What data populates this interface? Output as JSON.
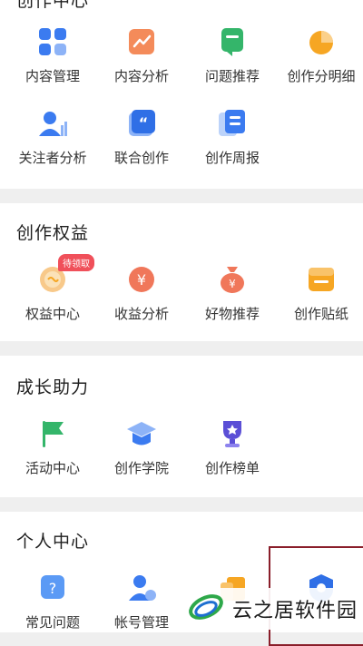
{
  "sections": {
    "creation": {
      "title": "创作中心",
      "items": [
        {
          "label": "内容管理",
          "icon": "grid-icon"
        },
        {
          "label": "内容分析",
          "icon": "chart-icon"
        },
        {
          "label": "问题推荐",
          "icon": "question-card-icon"
        },
        {
          "label": "创作分明细",
          "icon": "pie-icon"
        },
        {
          "label": "关注者分析",
          "icon": "follower-icon"
        },
        {
          "label": "联合创作",
          "icon": "quote-icon"
        },
        {
          "label": "创作周报",
          "icon": "report-icon"
        }
      ]
    },
    "rights": {
      "title": "创作权益",
      "items": [
        {
          "label": "权益中心",
          "icon": "rights-icon",
          "badge": "待领取"
        },
        {
          "label": "收益分析",
          "icon": "yuan-icon"
        },
        {
          "label": "好物推荐",
          "icon": "money-bag-icon"
        },
        {
          "label": "创作贴纸",
          "icon": "sticker-icon"
        }
      ]
    },
    "growth": {
      "title": "成长助力",
      "items": [
        {
          "label": "活动中心",
          "icon": "flag-icon"
        },
        {
          "label": "创作学院",
          "icon": "graduation-cap-icon"
        },
        {
          "label": "创作榜单",
          "icon": "trophy-icon"
        }
      ]
    },
    "personal": {
      "title": "个人中心",
      "items": [
        {
          "label": "常见问题",
          "icon": "help-icon"
        },
        {
          "label": "帐号管理",
          "icon": "account-icon"
        },
        {
          "label": "",
          "icon": "folder-icon"
        },
        {
          "label": "",
          "icon": "shield-home-icon"
        }
      ]
    }
  },
  "watermark": {
    "text": "云之居软件园"
  },
  "colors": {
    "blue": "#3b7bf0",
    "orange": "#f48b5a",
    "green": "#34b56a",
    "yellow": "#f6a623",
    "red_badge": "#f0505a"
  }
}
